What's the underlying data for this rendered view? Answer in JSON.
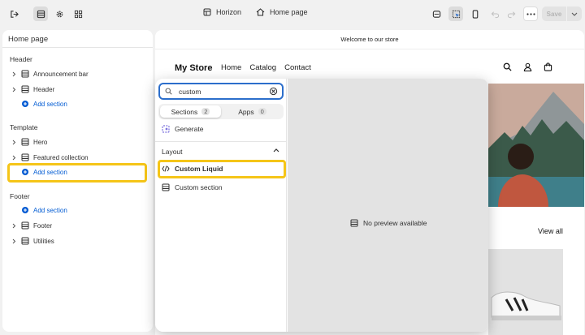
{
  "topbar": {
    "theme_name": "Horizon",
    "page_name": "Home page",
    "save_label": "Save"
  },
  "sidebar": {
    "title": "Home page",
    "groups": {
      "header": {
        "label": "Header",
        "items": [
          "Announcement bar",
          "Header"
        ],
        "add_label": "Add section"
      },
      "template": {
        "label": "Template",
        "items": [
          "Hero",
          "Featured collection"
        ],
        "add_label": "Add section"
      },
      "footer": {
        "label": "Footer",
        "add_label": "Add section",
        "items": [
          "Footer",
          "Utilities"
        ]
      }
    }
  },
  "preview": {
    "announcement": "Welcome to our store",
    "store_name": "My Store",
    "nav": [
      "Home",
      "Catalog",
      "Contact"
    ],
    "view_all": "View all"
  },
  "popup": {
    "search_value": "custom",
    "tabs": [
      {
        "label": "Sections",
        "count": "2"
      },
      {
        "label": "Apps",
        "count": "0"
      }
    ],
    "generate_label": "Generate",
    "layout_header": "Layout",
    "items": [
      "Custom Liquid",
      "Custom section"
    ],
    "no_preview": "No preview available"
  },
  "colors": {
    "highlight": "#f5c518",
    "link": "#005bd3",
    "focus": "#2c6ecb"
  }
}
